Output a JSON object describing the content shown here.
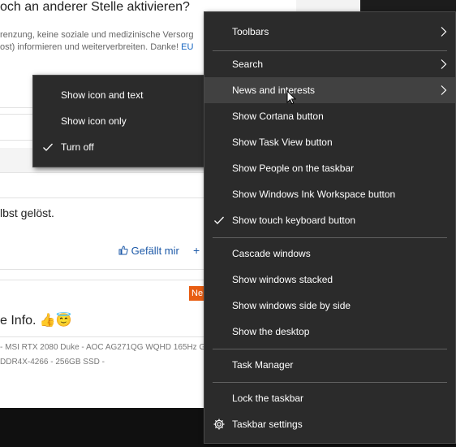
{
  "background": {
    "headline": "och an anderer Stelle aktivieren?",
    "subline1": "renzung, keine soziale und medizinische Versorg",
    "subline2": "ost) informieren und weiterverbreiten. Danke!",
    "subline2_link": "EU",
    "post_text": "lbst gelöst.",
    "like_label": "Gefällt mir",
    "plus": "+",
    "new_badge": "Ne",
    "info_text": "e Info. 👍😇",
    "signature1": "- MSI RTX 2080 Duke - AOC AG271QG WQHD 165Hz G-",
    "signature2": "DDR4X-4266 - 256GB SSD -",
    "colors": {
      "link": "#1565c0",
      "badge": "#e85d12",
      "taskbar": "#101010"
    }
  },
  "context_menu": {
    "background": "#2b2b2b",
    "hover_background": "#414141",
    "items": [
      {
        "label": "Toolbars",
        "submenu": true,
        "icon": "chevron-right-icon"
      },
      {
        "label": "Search",
        "submenu": true,
        "icon": "chevron-right-icon"
      },
      {
        "label": "News and interests",
        "submenu": true,
        "hovered": true,
        "icon": "chevron-right-icon"
      },
      {
        "label": "Show Cortana button"
      },
      {
        "label": "Show Task View button"
      },
      {
        "label": "Show People on the taskbar"
      },
      {
        "label": "Show Windows Ink Workspace button"
      },
      {
        "label": "Show touch keyboard button",
        "checked": true,
        "icon": "checkmark-icon"
      },
      {
        "label": "Cascade windows"
      },
      {
        "label": "Show windows stacked"
      },
      {
        "label": "Show windows side by side"
      },
      {
        "label": "Show the desktop"
      },
      {
        "label": "Task Manager"
      },
      {
        "label": "Lock the taskbar"
      },
      {
        "label": "Taskbar settings",
        "icon": "gear-icon"
      }
    ]
  },
  "news_submenu": {
    "items": [
      {
        "label": "Show icon and text"
      },
      {
        "label": "Show icon only"
      },
      {
        "label": "Turn off",
        "checked": true,
        "icon": "checkmark-icon"
      }
    ]
  }
}
